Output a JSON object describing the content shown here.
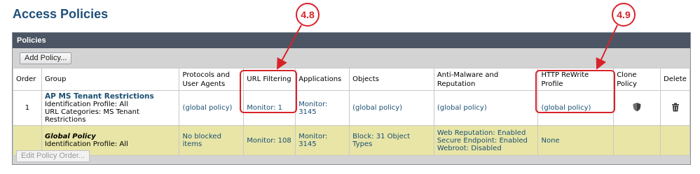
{
  "page": {
    "title": "Access Policies"
  },
  "panel": {
    "header": "Policies"
  },
  "toolbar": {
    "add_policy": "Add Policy...",
    "edit_policy_order": "Edit Policy Order..."
  },
  "columns": {
    "order": "Order",
    "group": "Group",
    "protocols_line1": "Protocols and",
    "protocols_line2": "User Agents",
    "url_filtering": "URL Filtering",
    "applications": "Applications",
    "objects": "Objects",
    "anti_malware": "Anti-Malware and Reputation",
    "http_rewrite": "HTTP ReWrite Profile",
    "clone": "Clone Policy",
    "delete": "Delete"
  },
  "rows": [
    {
      "order": "1",
      "group_name": "AP MS Tenant Restrictions",
      "group_line2": "Identification Profile: All",
      "group_line3": "URL Categories: MS Tenant Restrictions",
      "protocols": "(global policy)",
      "url_filtering": "Monitor: 1",
      "applications": "Monitor: 3145",
      "objects": "(global policy)",
      "anti_malware": "(global policy)",
      "http_rewrite": "(global policy)",
      "clone_icon": "shield-icon",
      "delete_icon": "trash-icon"
    },
    {
      "order": "",
      "group_name": "Global Policy",
      "group_line2": "Identification Profile: All",
      "protocols": "No blocked items",
      "url_filtering": "Monitor: 108",
      "applications": "Monitor: 3145",
      "objects": "Block: 31 Object Types",
      "anti_malware_1": "Web Reputation: Enabled",
      "anti_malware_2": "Secure Endpoint: Enabled",
      "anti_malware_3": "Webroot: Disabled",
      "http_rewrite": "None"
    }
  ],
  "callouts": [
    {
      "label": "4.8",
      "target": "URL Filtering"
    },
    {
      "label": "4.9",
      "target": "HTTP ReWrite Profile"
    }
  ],
  "colors": {
    "title": "#1f4e79",
    "panel_header": "#4b5563",
    "global_row": "#e8e5a7",
    "link": "#1b4f72",
    "callout": "#d8232a"
  }
}
